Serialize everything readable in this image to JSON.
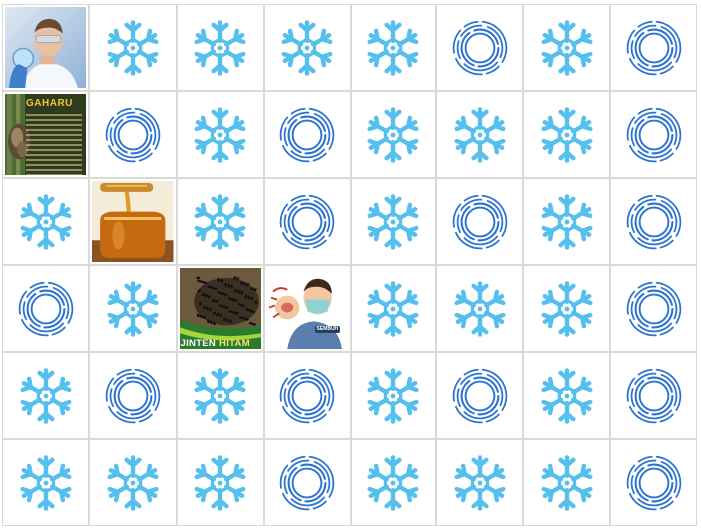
{
  "board": {
    "rows": 6,
    "cols": 8,
    "tiles": [
      [
        "photo-scientist",
        "snowflake",
        "snowflake",
        "snowflake",
        "snowflake",
        "rings",
        "snowflake",
        "rings"
      ],
      [
        "photo-gaharu",
        "rings",
        "snowflake",
        "rings",
        "snowflake",
        "snowflake",
        "snowflake",
        "rings"
      ],
      [
        "snowflake",
        "photo-honey",
        "snowflake",
        "rings",
        "snowflake",
        "rings",
        "snowflake",
        "rings"
      ],
      [
        "rings",
        "snowflake",
        "photo-jinten",
        "photo-sick-man",
        "snowflake",
        "snowflake",
        "snowflake",
        "rings"
      ],
      [
        "snowflake",
        "rings",
        "snowflake",
        "rings",
        "snowflake",
        "rings",
        "snowflake",
        "rings"
      ],
      [
        "snowflake",
        "snowflake",
        "snowflake",
        "rings",
        "snowflake",
        "snowflake",
        "snowflake",
        "rings"
      ]
    ]
  },
  "cards": {
    "gaharu_title": "GAHARU",
    "jinten_word1": "JINTEN",
    "jinten_word2": "HITAM",
    "sick_man_shirt": "SEMBUH"
  },
  "icons": {
    "hidden_a": "snowflake-icon",
    "hidden_b": "concentric-rings-icon"
  },
  "colors": {
    "snowflake": "#55bfee",
    "rings": "#2a73cf",
    "grid": "#d9d9d9"
  }
}
